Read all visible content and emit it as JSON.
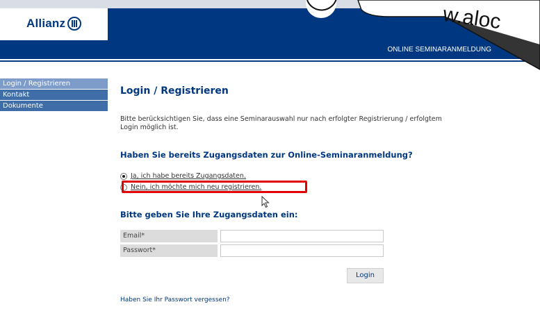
{
  "header": {
    "logo_text": "Allianz",
    "nav_label": "ONLINE SEMINARANMELDUNG"
  },
  "sidebar": {
    "items": [
      {
        "label": "Login / Registrieren"
      },
      {
        "label": "Kontakt"
      },
      {
        "label": "Dokumente"
      }
    ]
  },
  "main": {
    "title": "Login / Registrieren",
    "intro": "Bitte berücksichtigen Sie, dass eine Seminarauswahl nur nach erfolgter Registrierung / erfolgtem Login möglich ist.",
    "question_heading": "Haben Sie bereits Zugangsdaten zur Online-Seminaranmeldung?",
    "options": [
      {
        "label": "Ja, ich habe bereits Zugangsdaten.",
        "selected": true
      },
      {
        "label": "Nein, ich möchte mich neu registrieren.",
        "selected": false
      }
    ],
    "login_heading": "Bitte geben Sie Ihre Zugangsdaten ein:",
    "fields": {
      "email_label": "Email*",
      "email_value": "",
      "password_label": "Passwort*",
      "password_value": ""
    },
    "login_button": "Login",
    "forgot_link": "Haben Sie Ihr Passwort vergessen?"
  },
  "overlay": {
    "watermark": "w.aloc"
  },
  "colors": {
    "brand_blue": "#003781",
    "sidebar_blue": "#3e6da8",
    "highlight_red": "#e30000"
  }
}
